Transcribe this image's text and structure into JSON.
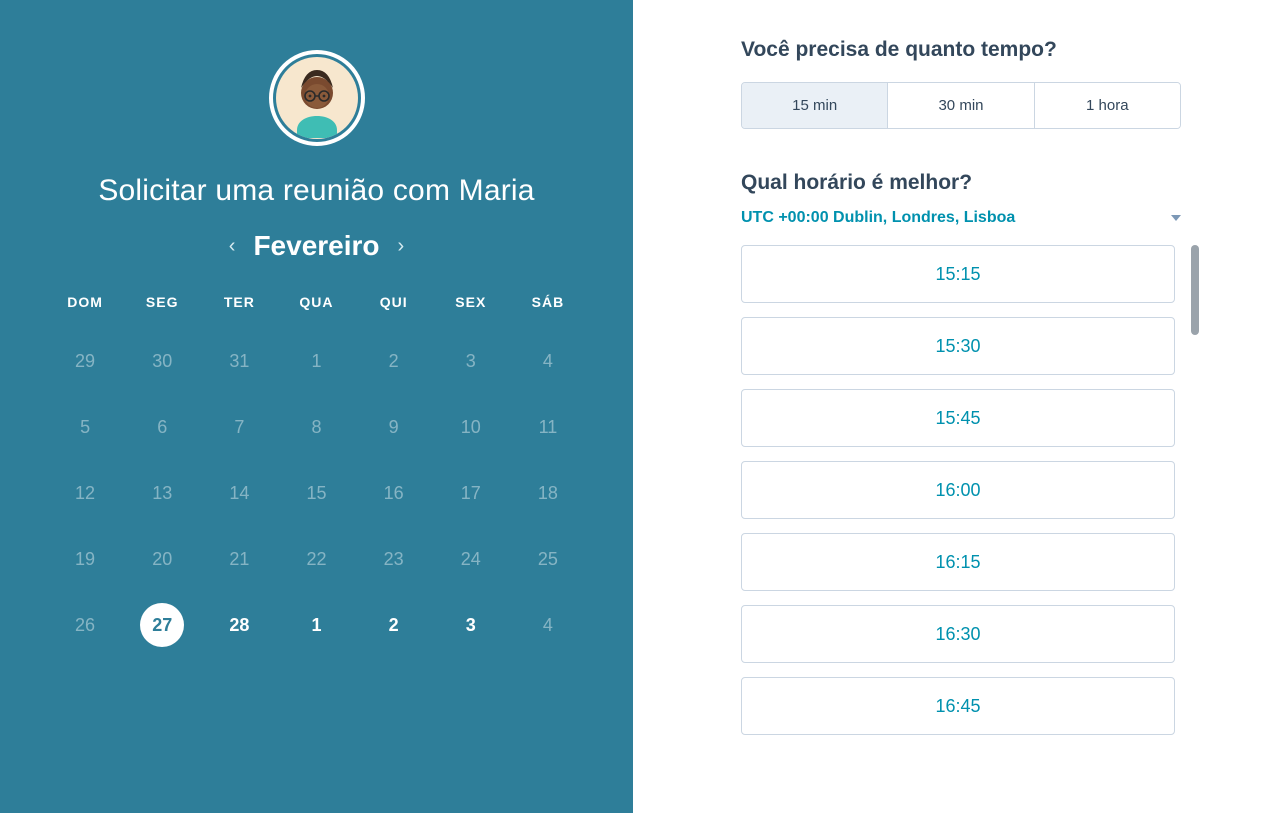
{
  "left": {
    "title": "Solicitar uma reunião com Maria",
    "month": "Fevereiro",
    "weekdays": [
      "DOM",
      "SEG",
      "TER",
      "QUA",
      "QUI",
      "SEX",
      "SÁB"
    ],
    "weeks": [
      [
        {
          "n": "29",
          "dim": true
        },
        {
          "n": "30",
          "dim": true
        },
        {
          "n": "31",
          "dim": true
        },
        {
          "n": "1",
          "dim": true
        },
        {
          "n": "2",
          "dim": true
        },
        {
          "n": "3",
          "dim": true
        },
        {
          "n": "4",
          "dim": true
        }
      ],
      [
        {
          "n": "5",
          "dim": true
        },
        {
          "n": "6",
          "dim": true
        },
        {
          "n": "7",
          "dim": true
        },
        {
          "n": "8",
          "dim": true
        },
        {
          "n": "9",
          "dim": true
        },
        {
          "n": "10",
          "dim": true
        },
        {
          "n": "11",
          "dim": true
        }
      ],
      [
        {
          "n": "12",
          "dim": true
        },
        {
          "n": "13",
          "dim": true
        },
        {
          "n": "14",
          "dim": true
        },
        {
          "n": "15",
          "dim": true
        },
        {
          "n": "16",
          "dim": true
        },
        {
          "n": "17",
          "dim": true
        },
        {
          "n": "18",
          "dim": true
        }
      ],
      [
        {
          "n": "19",
          "dim": true
        },
        {
          "n": "20",
          "dim": true
        },
        {
          "n": "21",
          "dim": true
        },
        {
          "n": "22",
          "dim": true
        },
        {
          "n": "23",
          "dim": true
        },
        {
          "n": "24",
          "dim": true
        },
        {
          "n": "25",
          "dim": true
        }
      ],
      [
        {
          "n": "26",
          "dim": true
        },
        {
          "n": "27",
          "selected": true
        },
        {
          "n": "28",
          "avail": true
        },
        {
          "n": "1",
          "avail": true
        },
        {
          "n": "2",
          "avail": true
        },
        {
          "n": "3",
          "avail": true
        },
        {
          "n": "4",
          "dim": true
        }
      ]
    ]
  },
  "right": {
    "q1": "Você precisa de quanto tempo?",
    "durations": [
      {
        "label": "15 min",
        "active": true
      },
      {
        "label": "30 min",
        "active": false
      },
      {
        "label": "1 hora",
        "active": false
      }
    ],
    "q2": "Qual horário é melhor?",
    "timezone": "UTC +00:00 Dublin, Londres, Lisboa",
    "slots": [
      "15:15",
      "15:30",
      "15:45",
      "16:00",
      "16:15",
      "16:30",
      "16:45"
    ]
  }
}
